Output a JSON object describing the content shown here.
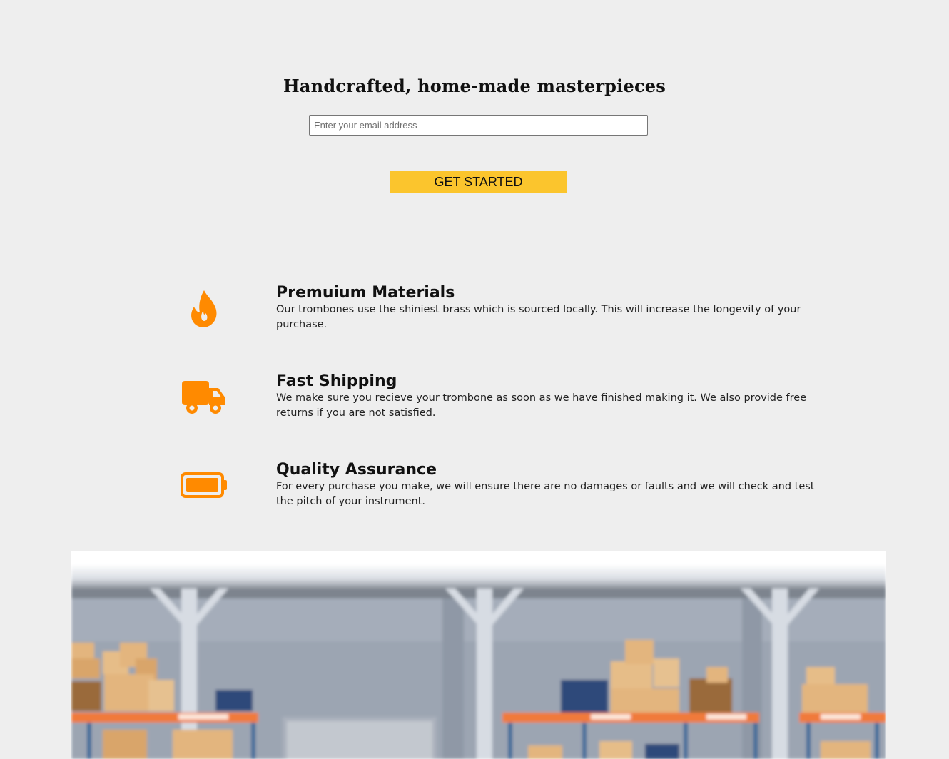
{
  "hero": {
    "title": "Handcrafted, home-made masterpieces",
    "email_placeholder": "Enter your email address",
    "email_value": "",
    "cta_label": "GET STARTED"
  },
  "features": [
    {
      "icon": "fire-icon",
      "title": "Premuium Materials",
      "description": "Our trombones use the shiniest brass which is sourced locally. This will increase the longevity of your purchase."
    },
    {
      "icon": "truck-icon",
      "title": "Fast Shipping",
      "description": "We make sure you recieve your trombone as soon as we have finished making it. We also provide free returns if you are not satisfied."
    },
    {
      "icon": "battery-full-icon",
      "title": "Quality Assurance",
      "description": "For every purchase you make, we will ensure there are no damages or faults and we will check and test the pitch of your instrument."
    }
  ],
  "colors": {
    "background": "#eeeeee",
    "accent": "#fbc52d",
    "icon": "#ff8a00",
    "text": "#111111"
  },
  "media": {
    "warehouse_image": "warehouse-illustration"
  }
}
